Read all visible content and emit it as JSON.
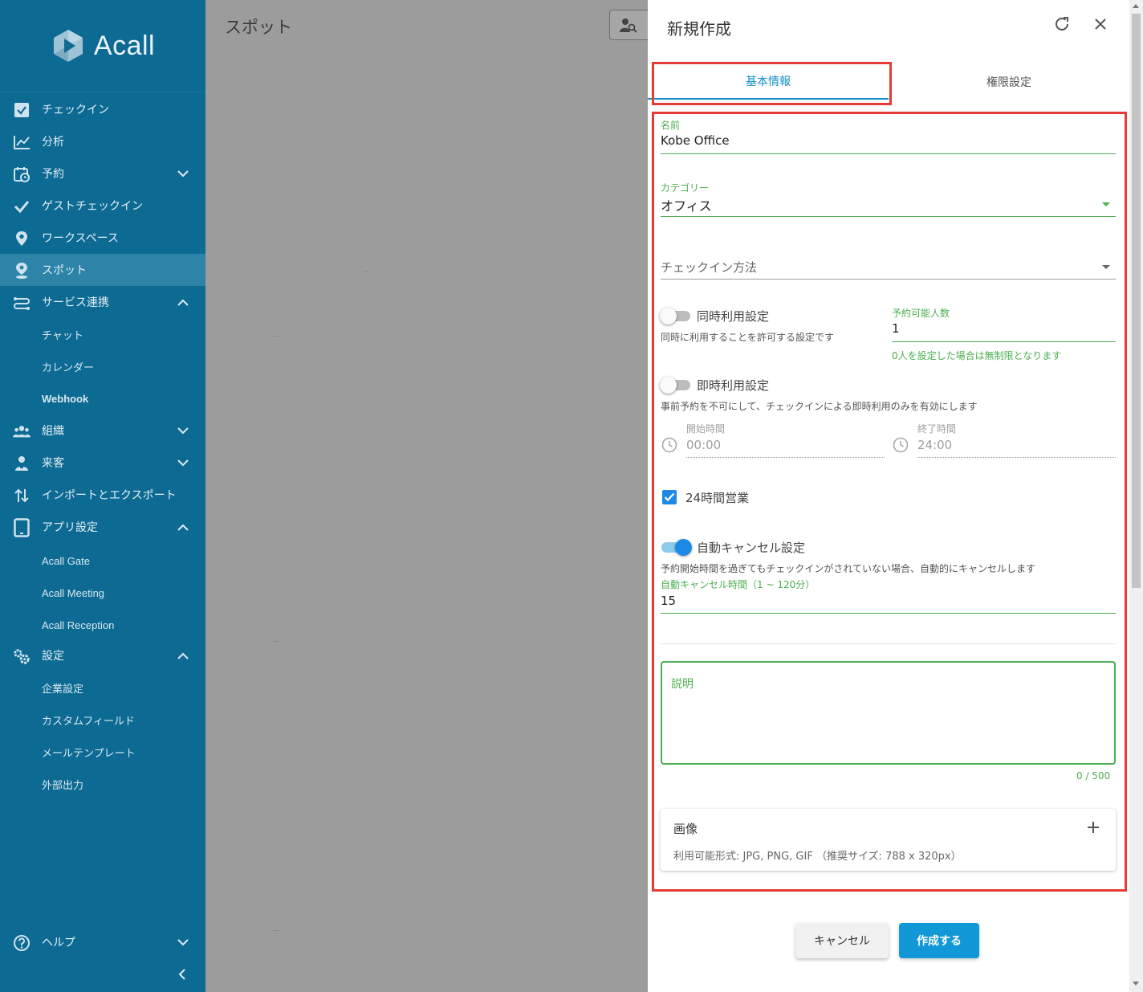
{
  "sidebar": {
    "brand": "Acall",
    "items": [
      {
        "label": "チェックイン",
        "icon": "checkbox-icon"
      },
      {
        "label": "分析",
        "icon": "chart-line-icon"
      },
      {
        "label": "予約",
        "icon": "calendar-clock-icon"
      },
      {
        "label": "ゲストチェックイン",
        "icon": "check-icon"
      },
      {
        "label": "ワークスペース",
        "icon": "map-pin-icon"
      },
      {
        "label": "スポット",
        "icon": "spot-person-pin-icon"
      },
      {
        "label": "サービス連携",
        "icon": "service-link-icon"
      },
      {
        "label": "組織",
        "icon": "group-icon"
      },
      {
        "label": "来客",
        "icon": "visitor-icon"
      },
      {
        "label": "インポートとエクスポート",
        "icon": "import-export-icon"
      },
      {
        "label": "アプリ設定",
        "icon": "tablet-icon"
      },
      {
        "label": "設定",
        "icon": "gears-icon"
      },
      {
        "label": "ヘルプ",
        "icon": "help-circle-icon"
      }
    ],
    "sub_service": [
      "チャット",
      "カレンダー",
      "Webhook"
    ],
    "sub_app": [
      "Acall Gate",
      "Acall Meeting",
      "Acall Reception"
    ],
    "sub_settings": [
      "企業設定",
      "カスタムフィールド",
      "メールテンプレート",
      "外部出力"
    ]
  },
  "main": {
    "title": "スポット"
  },
  "drawer": {
    "title": "新規作成",
    "tabs": [
      "基本情報",
      "権限設定"
    ],
    "name": {
      "label": "名前",
      "value": "Kobe Office"
    },
    "category": {
      "label": "カテゴリー",
      "value": "オフィス"
    },
    "checkin_method": {
      "placeholder": "チェックイン方法"
    },
    "concurrent": {
      "label": "同時利用設定",
      "hint": "同時に利用することを許可する設定です",
      "enabled": false
    },
    "capacity": {
      "label": "予約可能人数",
      "value": "1",
      "hint": "0人を設定した場合は無制限となります"
    },
    "instant": {
      "label": "即時利用設定",
      "hint": "事前予約を不可にして、チェックインによる即時利用のみを有効にします",
      "enabled": false
    },
    "start_time": {
      "label": "開始時間",
      "value": "00:00"
    },
    "end_time": {
      "label": "終了時間",
      "value": "24:00"
    },
    "open24": {
      "label": "24時間営業",
      "checked": true
    },
    "auto_cancel": {
      "label": "自動キャンセル設定",
      "hint": "予約開始時間を過ぎてもチェックインがされていない場合、自動的にキャンセルします",
      "enabled": true,
      "minutes_label": "自動キャンセル時間（1 ~ 120分）",
      "minutes_value": "15"
    },
    "description": {
      "label": "説明",
      "counter": "0 / 500"
    },
    "image": {
      "title": "画像",
      "hint": "利用可能形式: JPG, PNG, GIF （推奨サイズ: 788 x 320px）"
    },
    "buttons": {
      "cancel": "キャンセル",
      "create": "作成する"
    }
  },
  "colors": {
    "sidebar_bg": "#0d6a93",
    "accent": "#0e8fc6",
    "field_green": "#4caf50",
    "highlight_red": "#e53a35",
    "toggle_on": "#1e88e5"
  }
}
